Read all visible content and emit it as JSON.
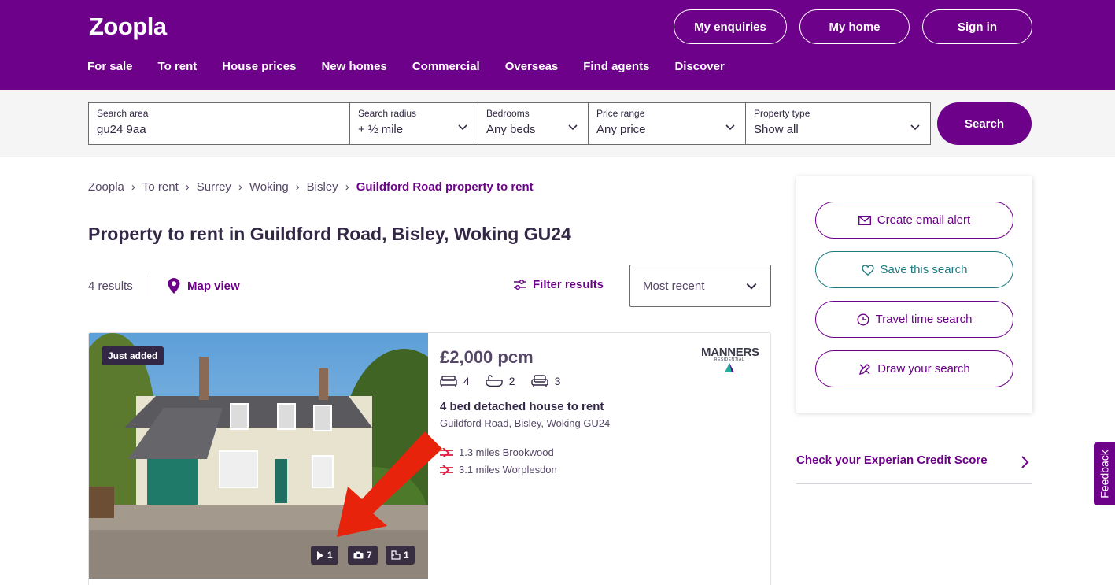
{
  "header": {
    "logo": "Zoopla",
    "buttons": [
      "My enquiries",
      "My home",
      "Sign in"
    ],
    "nav": [
      "For sale",
      "To rent",
      "House prices",
      "New homes",
      "Commercial",
      "Overseas",
      "Find agents",
      "Discover"
    ],
    "brand_color": "#6d0189"
  },
  "search": {
    "area_label": "Search area",
    "area_value": "gu24 9aa",
    "radius_label": "Search radius",
    "radius_value": "+ ½ mile",
    "bedrooms_label": "Bedrooms",
    "bedrooms_value": "Any beds",
    "price_label": "Price range",
    "price_value": "Any price",
    "type_label": "Property type",
    "type_value": "Show all",
    "button": "Search"
  },
  "breadcrumb": [
    "Zoopla",
    "To rent",
    "Surrey",
    "Woking",
    "Bisley"
  ],
  "breadcrumb_current": "Guildford Road property to rent",
  "page_title": "Property to rent in Guildford Road, Bisley, Woking GU24",
  "results": {
    "count": "4 results",
    "map_view": "Map view",
    "filter": "Filter results",
    "sort_value": "Most recent"
  },
  "listing": {
    "badge": "Just added",
    "price": "£2,000 pcm",
    "beds": "4",
    "baths": "2",
    "receptions": "3",
    "title": "4 bed detached house to rent",
    "address": "Guildford Road, Bisley, Woking GU24",
    "stations": [
      "1.3 miles Brookwood",
      "3.1 miles Worplesdon"
    ],
    "media": {
      "videos": "1",
      "photos": "7",
      "floorplans": "1"
    },
    "agent_name": "MANNERS",
    "agent_sub": "RESIDENTIAL"
  },
  "panel": {
    "email_alert": "Create email alert",
    "save_search": "Save this search",
    "travel_time": "Travel time search",
    "draw_search": "Draw your search"
  },
  "credit_link": "Check your Experian Credit Score",
  "feedback": "Feedback"
}
